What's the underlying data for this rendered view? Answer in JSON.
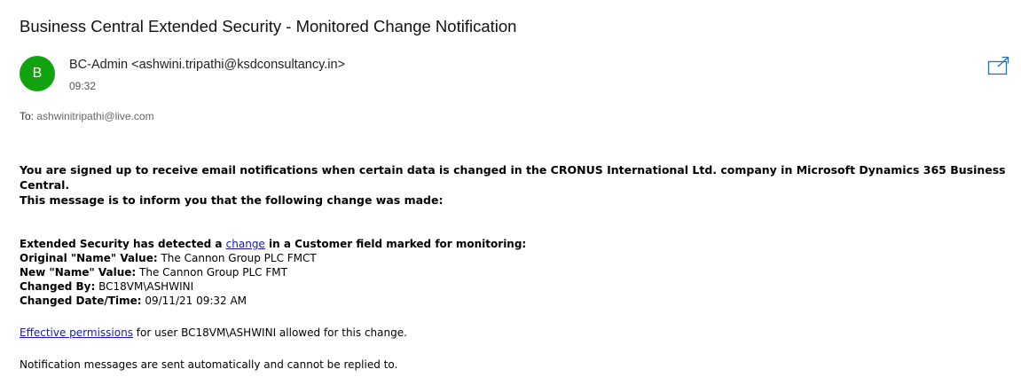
{
  "email": {
    "subject": "Business Central Extended Security - Monitored Change Notification",
    "avatar_letter": "B",
    "avatar_color": "#10a30f",
    "sender": "BC-Admin <ashwini.tripathi@ksdconsultancy.in>",
    "time": "09:32",
    "to_label": "To:",
    "to_address": "ashwinitripathi@live.com",
    "popout_icon": "open-in-new-window-icon"
  },
  "body": {
    "intro_line1": "You are signed up to receive email notifications when certain data is changed in the CRONUS International Ltd. company in Microsoft Dynamics 365 Business Central.",
    "intro_line2": "This message is to inform you that the following change was made:",
    "detected_prefix": "Extended Security has detected a ",
    "detected_link": "change",
    "detected_suffix": " in a Customer field marked for monitoring:",
    "original_label": "Original \"Name\" Value:",
    "original_value": " The Cannon Group PLC FMCT",
    "new_label": "New \"Name\" Value:",
    "new_value": " The Cannon Group PLC FMT",
    "changed_by_label": "Changed By:",
    "changed_by_value": " BC18VM\\ASHWINI",
    "changed_dt_label": "Changed Date/Time:",
    "changed_dt_value": " 09/11/21 09:32 AM",
    "perm_link": "Effective permissions",
    "perm_text": " for user BC18VM\\ASHWINI allowed for this change.",
    "footer": "Notification messages are sent automatically and cannot be replied to."
  }
}
